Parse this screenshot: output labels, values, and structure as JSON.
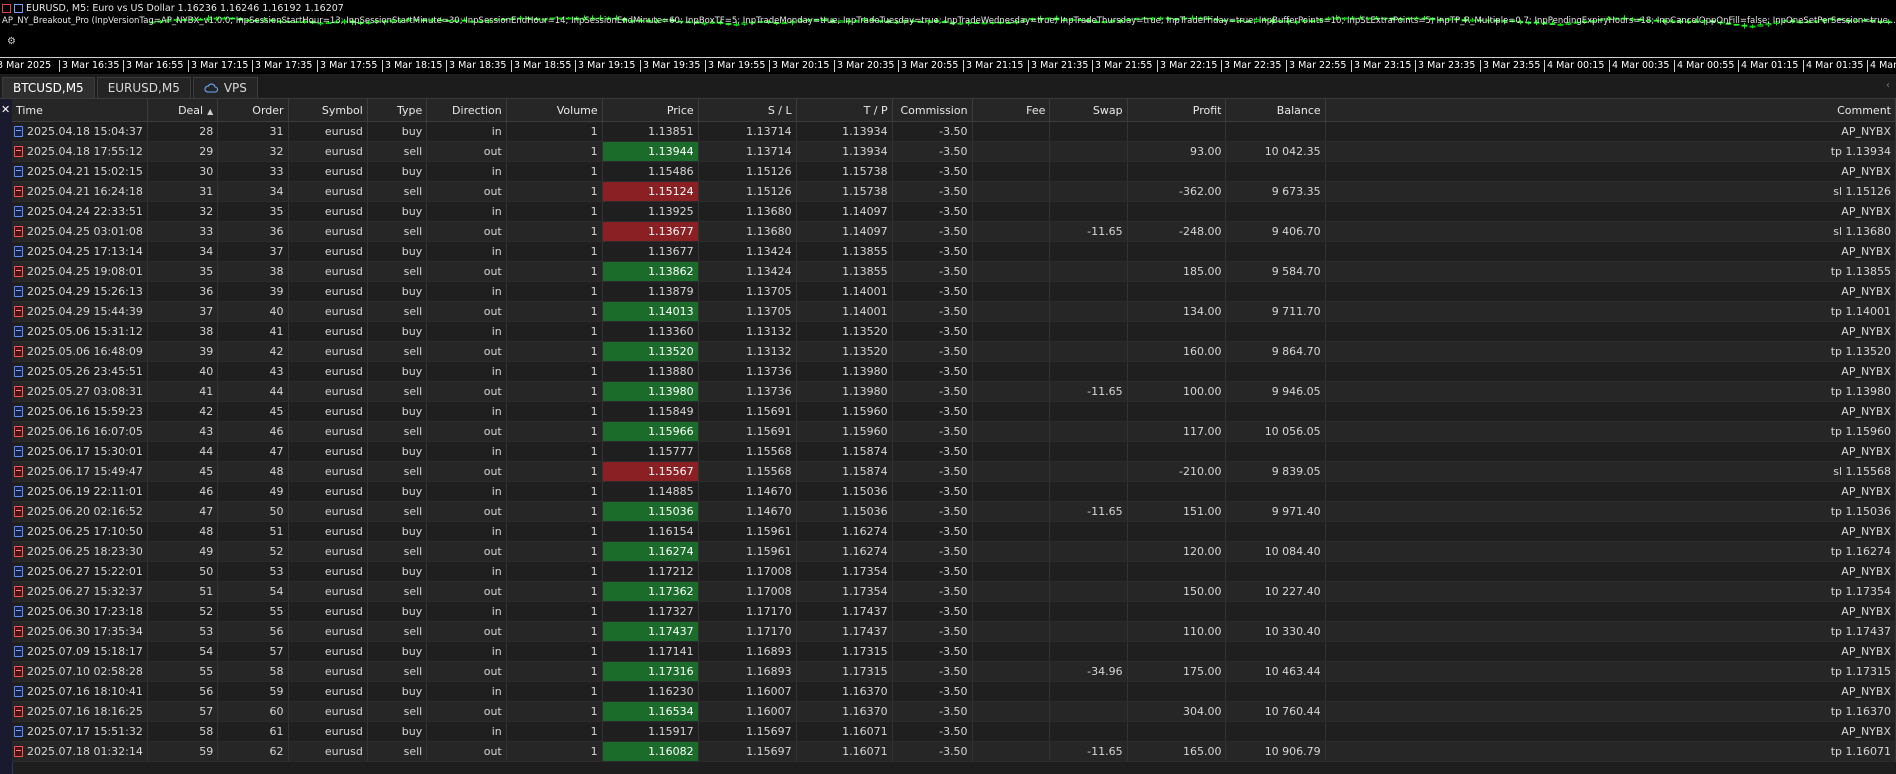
{
  "chart": {
    "symbol_title": "EURUSD, M5:  Euro vs US Dollar  1.16236 1.16246 1.16192 1.16207",
    "ea_params": "AP_NY_Breakout_Pro (InpVersionTag=AP_NYBX_v1.0.0; InpSessionStartHour=13; InpSessionStartMinute=30; InpSessionEndHour=14; InpSessionEndMinute=60; InpBoxTF=5; InpTradeMonday=true; InpTradeTuesday=true; InpTradeWednesday=true; InpTradeThursday=true; InpTradeFriday=true; InpBufferPoints=10; InpSLExtraPoints=5; InpTP_R_Multiple=0.7; InpPendingExpiryHours=18; InpCancelOppOnFill=false; InpOneSetPerSession=true...) 1.04938",
    "time_labels": [
      "3 Mar 2025",
      "3 Mar 16:35",
      "3 Mar 16:55",
      "3 Mar 17:15",
      "3 Mar 17:35",
      "3 Mar 17:55",
      "3 Mar 18:15",
      "3 Mar 18:35",
      "3 Mar 18:55",
      "3 Mar 19:15",
      "3 Mar 19:35",
      "3 Mar 19:55",
      "3 Mar 20:15",
      "3 Mar 20:35",
      "3 Mar 20:55",
      "3 Mar 21:15",
      "3 Mar 21:35",
      "3 Mar 21:55",
      "3 Mar 22:15",
      "3 Mar 22:35",
      "3 Mar 22:55",
      "3 Mar 23:15",
      "3 Mar 23:35",
      "3 Mar 23:55",
      "4 Mar 00:15",
      "4 Mar 00:35",
      "4 Mar 00:55",
      "4 Mar 01:15",
      "4 Mar 01:35",
      "4 Mar 01:5"
    ],
    "colors": {
      "bull": "#00ff00",
      "bear": "#ffffff",
      "background": "#000000"
    }
  },
  "tabs": [
    {
      "label": "BTCUSD,M5",
      "active": true
    },
    {
      "label": "EURUSD,M5",
      "active": false
    },
    {
      "label": "VPS",
      "active": false,
      "icon": "cloud-icon"
    }
  ],
  "columns": [
    "Time",
    "Deal",
    "Order",
    "Symbol",
    "Type",
    "Direction",
    "Volume",
    "Price",
    "S / L",
    "T / P",
    "Commission",
    "Fee",
    "Swap",
    "Profit",
    "Balance",
    "Comment"
  ],
  "sort": {
    "column": "Deal",
    "direction": "ascending"
  },
  "rows": [
    {
      "time": "2025.04.18 15:04:37",
      "deal": "28",
      "order": "31",
      "symbol": "eurusd",
      "type": "buy",
      "dir": "in",
      "vol": "1",
      "price": "1.13851",
      "pc": "",
      "sl": "1.13714",
      "tp": "1.13934",
      "comm": "-3.50",
      "fee": "",
      "swap": "",
      "profit": "",
      "balance": "",
      "comment": "AP_NYBX"
    },
    {
      "time": "2025.04.18 17:55:12",
      "deal": "29",
      "order": "32",
      "symbol": "eurusd",
      "type": "sell",
      "dir": "out",
      "vol": "1",
      "price": "1.13944",
      "pc": "win",
      "sl": "1.13714",
      "tp": "1.13934",
      "comm": "-3.50",
      "fee": "",
      "swap": "",
      "profit": "93.00",
      "balance": "10 042.35",
      "comment": "tp 1.13934"
    },
    {
      "time": "2025.04.21 15:02:15",
      "deal": "30",
      "order": "33",
      "symbol": "eurusd",
      "type": "buy",
      "dir": "in",
      "vol": "1",
      "price": "1.15486",
      "pc": "",
      "sl": "1.15126",
      "tp": "1.15738",
      "comm": "-3.50",
      "fee": "",
      "swap": "",
      "profit": "",
      "balance": "",
      "comment": "AP_NYBX"
    },
    {
      "time": "2025.04.21 16:24:18",
      "deal": "31",
      "order": "34",
      "symbol": "eurusd",
      "type": "sell",
      "dir": "out",
      "vol": "1",
      "price": "1.15124",
      "pc": "loss",
      "sl": "1.15126",
      "tp": "1.15738",
      "comm": "-3.50",
      "fee": "",
      "swap": "",
      "profit": "-362.00",
      "balance": "9 673.35",
      "comment": "sl 1.15126"
    },
    {
      "time": "2025.04.24 22:33:51",
      "deal": "32",
      "order": "35",
      "symbol": "eurusd",
      "type": "buy",
      "dir": "in",
      "vol": "1",
      "price": "1.13925",
      "pc": "",
      "sl": "1.13680",
      "tp": "1.14097",
      "comm": "-3.50",
      "fee": "",
      "swap": "",
      "profit": "",
      "balance": "",
      "comment": "AP_NYBX"
    },
    {
      "time": "2025.04.25 03:01:08",
      "deal": "33",
      "order": "36",
      "symbol": "eurusd",
      "type": "sell",
      "dir": "out",
      "vol": "1",
      "price": "1.13677",
      "pc": "loss",
      "sl": "1.13680",
      "tp": "1.14097",
      "comm": "-3.50",
      "fee": "",
      "swap": "-11.65",
      "profit": "-248.00",
      "balance": "9 406.70",
      "comment": "sl 1.13680"
    },
    {
      "time": "2025.04.25 17:13:14",
      "deal": "34",
      "order": "37",
      "symbol": "eurusd",
      "type": "buy",
      "dir": "in",
      "vol": "1",
      "price": "1.13677",
      "pc": "",
      "sl": "1.13424",
      "tp": "1.13855",
      "comm": "-3.50",
      "fee": "",
      "swap": "",
      "profit": "",
      "balance": "",
      "comment": "AP_NYBX"
    },
    {
      "time": "2025.04.25 19:08:01",
      "deal": "35",
      "order": "38",
      "symbol": "eurusd",
      "type": "sell",
      "dir": "out",
      "vol": "1",
      "price": "1.13862",
      "pc": "win",
      "sl": "1.13424",
      "tp": "1.13855",
      "comm": "-3.50",
      "fee": "",
      "swap": "",
      "profit": "185.00",
      "balance": "9 584.70",
      "comment": "tp 1.13855"
    },
    {
      "time": "2025.04.29 15:26:13",
      "deal": "36",
      "order": "39",
      "symbol": "eurusd",
      "type": "buy",
      "dir": "in",
      "vol": "1",
      "price": "1.13879",
      "pc": "",
      "sl": "1.13705",
      "tp": "1.14001",
      "comm": "-3.50",
      "fee": "",
      "swap": "",
      "profit": "",
      "balance": "",
      "comment": "AP_NYBX"
    },
    {
      "time": "2025.04.29 15:44:39",
      "deal": "37",
      "order": "40",
      "symbol": "eurusd",
      "type": "sell",
      "dir": "out",
      "vol": "1",
      "price": "1.14013",
      "pc": "win",
      "sl": "1.13705",
      "tp": "1.14001",
      "comm": "-3.50",
      "fee": "",
      "swap": "",
      "profit": "134.00",
      "balance": "9 711.70",
      "comment": "tp 1.14001"
    },
    {
      "time": "2025.05.06 15:31:12",
      "deal": "38",
      "order": "41",
      "symbol": "eurusd",
      "type": "buy",
      "dir": "in",
      "vol": "1",
      "price": "1.13360",
      "pc": "",
      "sl": "1.13132",
      "tp": "1.13520",
      "comm": "-3.50",
      "fee": "",
      "swap": "",
      "profit": "",
      "balance": "",
      "comment": "AP_NYBX"
    },
    {
      "time": "2025.05.06 16:48:09",
      "deal": "39",
      "order": "42",
      "symbol": "eurusd",
      "type": "sell",
      "dir": "out",
      "vol": "1",
      "price": "1.13520",
      "pc": "win",
      "sl": "1.13132",
      "tp": "1.13520",
      "comm": "-3.50",
      "fee": "",
      "swap": "",
      "profit": "160.00",
      "balance": "9 864.70",
      "comment": "tp 1.13520"
    },
    {
      "time": "2025.05.26 23:45:51",
      "deal": "40",
      "order": "43",
      "symbol": "eurusd",
      "type": "buy",
      "dir": "in",
      "vol": "1",
      "price": "1.13880",
      "pc": "",
      "sl": "1.13736",
      "tp": "1.13980",
      "comm": "-3.50",
      "fee": "",
      "swap": "",
      "profit": "",
      "balance": "",
      "comment": "AP_NYBX"
    },
    {
      "time": "2025.05.27 03:08:31",
      "deal": "41",
      "order": "44",
      "symbol": "eurusd",
      "type": "sell",
      "dir": "out",
      "vol": "1",
      "price": "1.13980",
      "pc": "win",
      "sl": "1.13736",
      "tp": "1.13980",
      "comm": "-3.50",
      "fee": "",
      "swap": "-11.65",
      "profit": "100.00",
      "balance": "9 946.05",
      "comment": "tp 1.13980"
    },
    {
      "time": "2025.06.16 15:59:23",
      "deal": "42",
      "order": "45",
      "symbol": "eurusd",
      "type": "buy",
      "dir": "in",
      "vol": "1",
      "price": "1.15849",
      "pc": "",
      "sl": "1.15691",
      "tp": "1.15960",
      "comm": "-3.50",
      "fee": "",
      "swap": "",
      "profit": "",
      "balance": "",
      "comment": "AP_NYBX"
    },
    {
      "time": "2025.06.16 16:07:05",
      "deal": "43",
      "order": "46",
      "symbol": "eurusd",
      "type": "sell",
      "dir": "out",
      "vol": "1",
      "price": "1.15966",
      "pc": "win",
      "sl": "1.15691",
      "tp": "1.15960",
      "comm": "-3.50",
      "fee": "",
      "swap": "",
      "profit": "117.00",
      "balance": "10 056.05",
      "comment": "tp 1.15960"
    },
    {
      "time": "2025.06.17 15:30:01",
      "deal": "44",
      "order": "47",
      "symbol": "eurusd",
      "type": "buy",
      "dir": "in",
      "vol": "1",
      "price": "1.15777",
      "pc": "",
      "sl": "1.15568",
      "tp": "1.15874",
      "comm": "-3.50",
      "fee": "",
      "swap": "",
      "profit": "",
      "balance": "",
      "comment": "AP_NYBX"
    },
    {
      "time": "2025.06.17 15:49:47",
      "deal": "45",
      "order": "48",
      "symbol": "eurusd",
      "type": "sell",
      "dir": "out",
      "vol": "1",
      "price": "1.15567",
      "pc": "loss",
      "sl": "1.15568",
      "tp": "1.15874",
      "comm": "-3.50",
      "fee": "",
      "swap": "",
      "profit": "-210.00",
      "balance": "9 839.05",
      "comment": "sl 1.15568"
    },
    {
      "time": "2025.06.19 22:11:01",
      "deal": "46",
      "order": "49",
      "symbol": "eurusd",
      "type": "buy",
      "dir": "in",
      "vol": "1",
      "price": "1.14885",
      "pc": "",
      "sl": "1.14670",
      "tp": "1.15036",
      "comm": "-3.50",
      "fee": "",
      "swap": "",
      "profit": "",
      "balance": "",
      "comment": "AP_NYBX"
    },
    {
      "time": "2025.06.20 02:16:52",
      "deal": "47",
      "order": "50",
      "symbol": "eurusd",
      "type": "sell",
      "dir": "out",
      "vol": "1",
      "price": "1.15036",
      "pc": "win",
      "sl": "1.14670",
      "tp": "1.15036",
      "comm": "-3.50",
      "fee": "",
      "swap": "-11.65",
      "profit": "151.00",
      "balance": "9 971.40",
      "comment": "tp 1.15036"
    },
    {
      "time": "2025.06.25 17:10:50",
      "deal": "48",
      "order": "51",
      "symbol": "eurusd",
      "type": "buy",
      "dir": "in",
      "vol": "1",
      "price": "1.16154",
      "pc": "",
      "sl": "1.15961",
      "tp": "1.16274",
      "comm": "-3.50",
      "fee": "",
      "swap": "",
      "profit": "",
      "balance": "",
      "comment": "AP_NYBX"
    },
    {
      "time": "2025.06.25 18:23:30",
      "deal": "49",
      "order": "52",
      "symbol": "eurusd",
      "type": "sell",
      "dir": "out",
      "vol": "1",
      "price": "1.16274",
      "pc": "win",
      "sl": "1.15961",
      "tp": "1.16274",
      "comm": "-3.50",
      "fee": "",
      "swap": "",
      "profit": "120.00",
      "balance": "10 084.40",
      "comment": "tp 1.16274"
    },
    {
      "time": "2025.06.27 15:22:01",
      "deal": "50",
      "order": "53",
      "symbol": "eurusd",
      "type": "buy",
      "dir": "in",
      "vol": "1",
      "price": "1.17212",
      "pc": "",
      "sl": "1.17008",
      "tp": "1.17354",
      "comm": "-3.50",
      "fee": "",
      "swap": "",
      "profit": "",
      "balance": "",
      "comment": "AP_NYBX"
    },
    {
      "time": "2025.06.27 15:32:37",
      "deal": "51",
      "order": "54",
      "symbol": "eurusd",
      "type": "sell",
      "dir": "out",
      "vol": "1",
      "price": "1.17362",
      "pc": "win",
      "sl": "1.17008",
      "tp": "1.17354",
      "comm": "-3.50",
      "fee": "",
      "swap": "",
      "profit": "150.00",
      "balance": "10 227.40",
      "comment": "tp 1.17354"
    },
    {
      "time": "2025.06.30 17:23:18",
      "deal": "52",
      "order": "55",
      "symbol": "eurusd",
      "type": "buy",
      "dir": "in",
      "vol": "1",
      "price": "1.17327",
      "pc": "",
      "sl": "1.17170",
      "tp": "1.17437",
      "comm": "-3.50",
      "fee": "",
      "swap": "",
      "profit": "",
      "balance": "",
      "comment": "AP_NYBX"
    },
    {
      "time": "2025.06.30 17:35:34",
      "deal": "53",
      "order": "56",
      "symbol": "eurusd",
      "type": "sell",
      "dir": "out",
      "vol": "1",
      "price": "1.17437",
      "pc": "win",
      "sl": "1.17170",
      "tp": "1.17437",
      "comm": "-3.50",
      "fee": "",
      "swap": "",
      "profit": "110.00",
      "balance": "10 330.40",
      "comment": "tp 1.17437"
    },
    {
      "time": "2025.07.09 15:18:17",
      "deal": "54",
      "order": "57",
      "symbol": "eurusd",
      "type": "buy",
      "dir": "in",
      "vol": "1",
      "price": "1.17141",
      "pc": "",
      "sl": "1.16893",
      "tp": "1.17315",
      "comm": "-3.50",
      "fee": "",
      "swap": "",
      "profit": "",
      "balance": "",
      "comment": "AP_NYBX"
    },
    {
      "time": "2025.07.10 02:58:28",
      "deal": "55",
      "order": "58",
      "symbol": "eurusd",
      "type": "sell",
      "dir": "out",
      "vol": "1",
      "price": "1.17316",
      "pc": "win",
      "sl": "1.16893",
      "tp": "1.17315",
      "comm": "-3.50",
      "fee": "",
      "swap": "-34.96",
      "profit": "175.00",
      "balance": "10 463.44",
      "comment": "tp 1.17315"
    },
    {
      "time": "2025.07.16 18:10:41",
      "deal": "56",
      "order": "59",
      "symbol": "eurusd",
      "type": "buy",
      "dir": "in",
      "vol": "1",
      "price": "1.16230",
      "pc": "",
      "sl": "1.16007",
      "tp": "1.16370",
      "comm": "-3.50",
      "fee": "",
      "swap": "",
      "profit": "",
      "balance": "",
      "comment": "AP_NYBX"
    },
    {
      "time": "2025.07.16 18:16:25",
      "deal": "57",
      "order": "60",
      "symbol": "eurusd",
      "type": "sell",
      "dir": "out",
      "vol": "1",
      "price": "1.16534",
      "pc": "win",
      "sl": "1.16007",
      "tp": "1.16370",
      "comm": "-3.50",
      "fee": "",
      "swap": "",
      "profit": "304.00",
      "balance": "10 760.44",
      "comment": "tp 1.16370"
    },
    {
      "time": "2025.07.17 15:51:32",
      "deal": "58",
      "order": "61",
      "symbol": "eurusd",
      "type": "buy",
      "dir": "in",
      "vol": "1",
      "price": "1.15917",
      "pc": "",
      "sl": "1.15697",
      "tp": "1.16071",
      "comm": "-3.50",
      "fee": "",
      "swap": "",
      "profit": "",
      "balance": "",
      "comment": "AP_NYBX"
    },
    {
      "time": "2025.07.18 01:32:14",
      "deal": "59",
      "order": "62",
      "symbol": "eurusd",
      "type": "sell",
      "dir": "out",
      "vol": "1",
      "price": "1.16082",
      "pc": "win",
      "sl": "1.15697",
      "tp": "1.16071",
      "comm": "-3.50",
      "fee": "",
      "swap": "-11.65",
      "profit": "165.00",
      "balance": "10 906.79",
      "comment": "tp 1.16071"
    }
  ]
}
